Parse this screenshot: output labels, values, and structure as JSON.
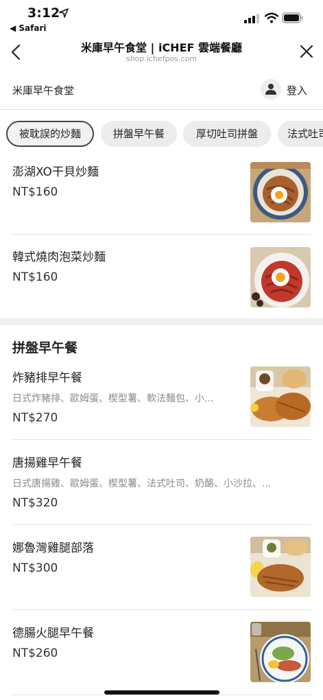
{
  "status_bar": {
    "time": "3:12",
    "back_app": "◀ Safari"
  },
  "header": {
    "title": "米庫早午食堂 | iCHEF 雲端餐廳",
    "subtitle": "shop.ichefpos.com"
  },
  "store": {
    "name": "米庫早午食堂",
    "login_label": "登入"
  },
  "categories": [
    {
      "label": "被耽誤的炒麵",
      "active": true
    },
    {
      "label": "拼盤早午餐",
      "active": false
    },
    {
      "label": "厚切吐司拼盤",
      "active": false
    },
    {
      "label": "法式吐司",
      "active": false
    }
  ],
  "sections": [
    {
      "title": "",
      "items": [
        {
          "name": "澎湖XO干貝炒麵",
          "desc": "",
          "price": "NT$160",
          "image": "noodle-egg-photo"
        },
        {
          "name": "韓式燒肉泡菜炒麵",
          "desc": "",
          "price": "NT$160",
          "image": "kimchi-noodle-photo"
        }
      ]
    },
    {
      "title": "拼盤早午餐",
      "items": [
        {
          "name": "炸豬排早午餐",
          "desc": "日式炸豬排、歐姆蛋、楔型薯、軟法麵包、小...",
          "price": "NT$270",
          "image": "pork-cutlet-photo"
        },
        {
          "name": "唐揚雞早午餐",
          "desc": "日式唐揚雞、歐姆蛋、楔型薯、法式吐司、奶酪、小沙拉、...",
          "price": "NT$320",
          "image": ""
        },
        {
          "name": "娜魯灣雞腿部落",
          "desc": "",
          "price": "NT$300",
          "image": "chicken-leg-photo"
        },
        {
          "name": "德腸火腿早午餐",
          "desc": "",
          "price": "NT$260",
          "image": "sausage-ham-photo"
        }
      ]
    }
  ],
  "colors": {
    "chip_bg": "#ececec",
    "chip_active_border": "#444444",
    "divider": "#e2e2e2",
    "muted_text": "#8a8a8a"
  }
}
